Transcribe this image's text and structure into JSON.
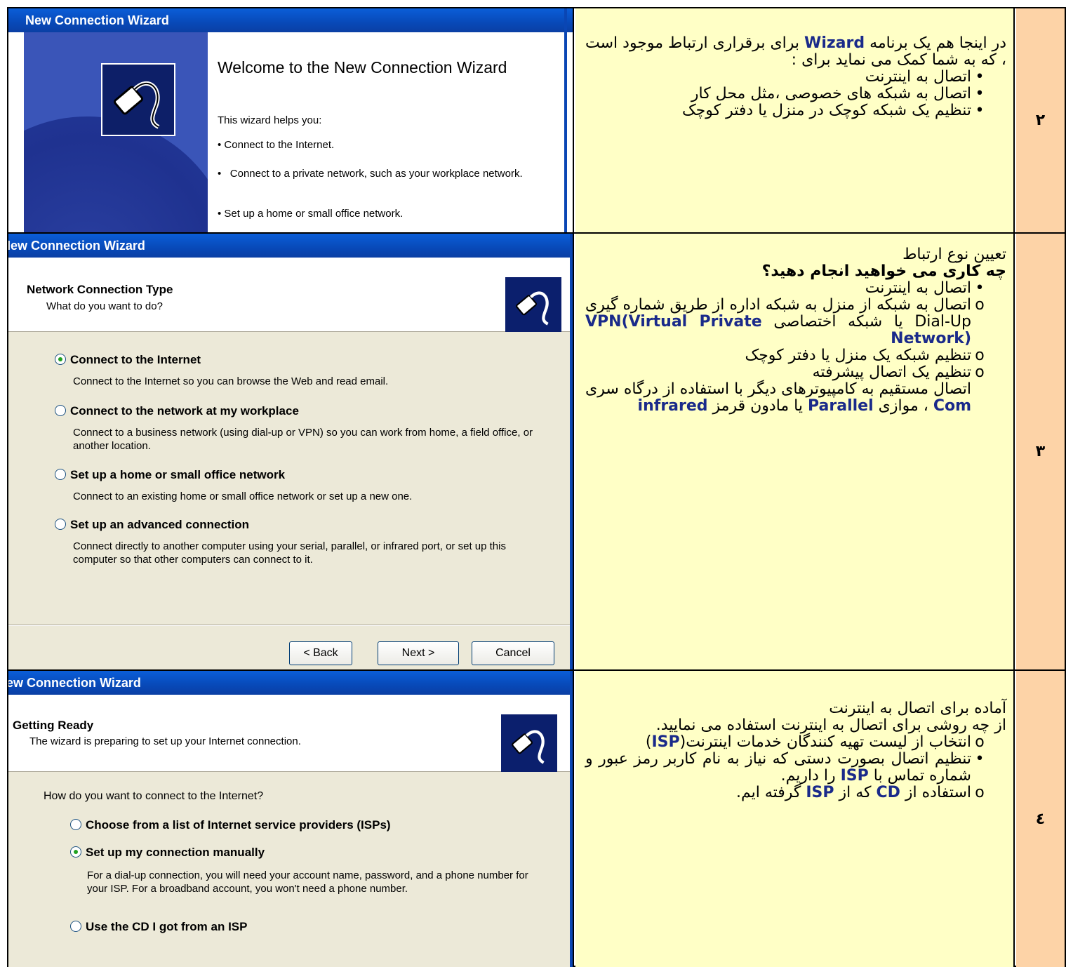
{
  "rows": [
    {
      "number": "۲",
      "wizard": {
        "title": "New Connection Wizard",
        "heading": "Welcome to the New Connection Wizard",
        "intro": "This wizard helps you:",
        "bullets": [
          "Connect to the Internet.",
          "Connect to a private network, such as your workplace network.",
          "Set up a home or small office network."
        ]
      },
      "text": {
        "p1_a": "در اینجا هم یک برنامه ",
        "p1_hl": "Wizard",
        "p1_b": " برای برقراری ارتباط موجود است ، که به شما کمک می نماید برای :",
        "items": [
          "اتصال به اینترنت",
          "اتصال به شبکه های خصوصی ،مثل محل کار",
          "تنظیم یک شبکه کوچک در منزل یا دفتر کوچک"
        ]
      }
    },
    {
      "number": "۳",
      "wizard": {
        "title": "New Connection Wizard",
        "header_title": "Network Connection Type",
        "header_sub": "What do you want to do?",
        "options": [
          {
            "label": "Connect to the Internet",
            "desc": "Connect to the Internet so you can browse the Web and read email.",
            "selected": true
          },
          {
            "label": "Connect to the network at my workplace",
            "desc": "Connect to a business network (using dial-up or VPN) so you can work from home, a field office, or another location.",
            "selected": false
          },
          {
            "label": "Set up a home or small office network",
            "desc": "Connect to an existing home or small office network or set up a new one.",
            "selected": false
          },
          {
            "label": "Set up an advanced connection",
            "desc": "Connect directly to another computer using your serial, parallel, or infrared port, or set up this computer so that other computers can connect to it.",
            "selected": false
          }
        ],
        "back_label": "< Back",
        "next_label": "Next >",
        "cancel_label": "Cancel"
      },
      "text": {
        "line1": "تعیین نوع ارتباط",
        "line2": "چه کاری می خواهید انجام دهید؟",
        "item1": "اتصال به اینترنت",
        "item2_a": "اتصال به شبکه از منزل به شبکه اداره از طریق شماره گیری Dial-Up یا شبکه اختصاصی ",
        "item2_hl": "VPN(Virtual Private Network)",
        "item3": "تنظیم شبکه یک منزل یا دفتر کوچک",
        "item4": "تنظیم یک اتصال پیشرفته",
        "p_a": "اتصال مستقیم به کامپیوترهای دیگر با استفاده از درگاه سری ",
        "p_hl1": "Com",
        "p_b": " ، موازی ",
        "p_hl2": "Parallel",
        "p_c": " یا مادون قرمز ",
        "p_hl3": "infrared"
      }
    },
    {
      "number": "٤",
      "wizard": {
        "title": "New Connection Wizard",
        "header_title": "Getting Ready",
        "header_sub": "The wizard is preparing to set up your Internet connection.",
        "question": "How do you want to connect to the Internet?",
        "options": [
          {
            "label": "Choose from a list of Internet service providers (ISPs)",
            "selected": false
          },
          {
            "label": "Set up my connection manually",
            "selected": true
          },
          {
            "label": "Use the CD I got from an ISP",
            "selected": false
          }
        ],
        "manual_desc": "For a dial-up connection, you will need your account name, password, and a phone number for your ISP. For a broadband account, you won't need a phone number."
      },
      "text": {
        "line1": "آماده برای اتصال به اینترنت",
        "line2": "از چه روشی برای اتصال به اینترنت استفاده می نمایید.",
        "item1_a": "انتخاب از لیست تهیه کنندگان خدمات اینترنت(",
        "item1_hl": "ISP",
        "item1_b": ")",
        "item2_a": "تنظیم اتصال بصورت دستی که نیاز به نام کاربر رمز عبور و شماره تماس با ",
        "item2_hl": "ISP",
        "item2_b": " را داریم.",
        "item3_a": "استفاده از ",
        "item3_hl1": "CD",
        "item3_b": " که از ",
        "item3_hl2": "ISP",
        "item3_c": " گرفته ایم."
      }
    }
  ]
}
